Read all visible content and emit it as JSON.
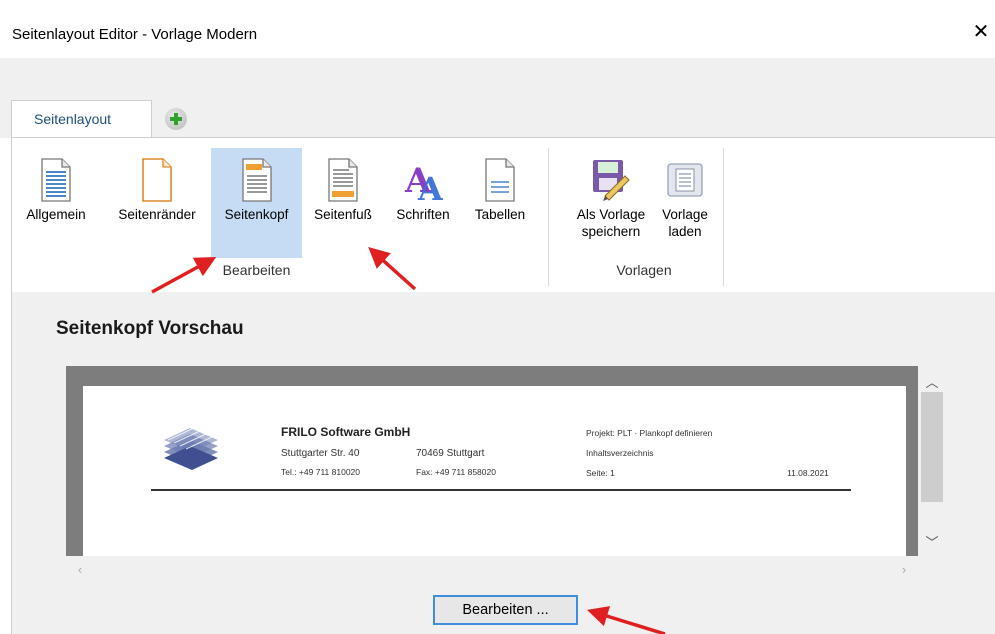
{
  "window": {
    "title": "Seitenlayout Editor - Vorlage Modern",
    "close_glyph": "✕"
  },
  "tabs": [
    {
      "label": "Seitenlayout",
      "active": true
    }
  ],
  "add_tab_icon": "plus-circle-icon",
  "ribbon": {
    "groups": [
      {
        "label": "Bearbeiten",
        "buttons": [
          {
            "label": "Allgemein",
            "icon": "document-lines-icon"
          },
          {
            "label": "Seitenränder",
            "icon": "page-margins-icon"
          },
          {
            "label": "Seitenkopf",
            "icon": "page-header-icon",
            "selected": true
          },
          {
            "label": "Seitenfuß",
            "icon": "page-footer-icon"
          },
          {
            "label": "Schriften",
            "icon": "fonts-icon"
          },
          {
            "label": "Tabellen",
            "icon": "tables-icon"
          }
        ]
      },
      {
        "label": "Vorlagen",
        "buttons": [
          {
            "label": "Als Vorlage\nspeichern",
            "icon": "save-template-icon"
          },
          {
            "label": "Vorlage\nladen",
            "icon": "load-template-icon"
          }
        ]
      }
    ]
  },
  "preview": {
    "title": "Seitenkopf Vorschau",
    "company": "FRILO Software GmbH",
    "street": "Stuttgarter Str. 40",
    "city": "70469  Stuttgart",
    "tel": "Tel.: +49 711 810020",
    "fax": "Fax: +49 711 858020",
    "project": "Projekt: PLT · Plankopf definieren",
    "subject": "Inhaltsverzeichnis",
    "page": "Seite: 1",
    "date": "11.08.2021"
  },
  "buttons": {
    "edit": "Bearbeiten ..."
  },
  "colors": {
    "selected_bg": "#c6dcf4",
    "tab_text": "#1e4e79",
    "arrow_red": "#e02020",
    "focus_border": "#3c8fd8"
  }
}
